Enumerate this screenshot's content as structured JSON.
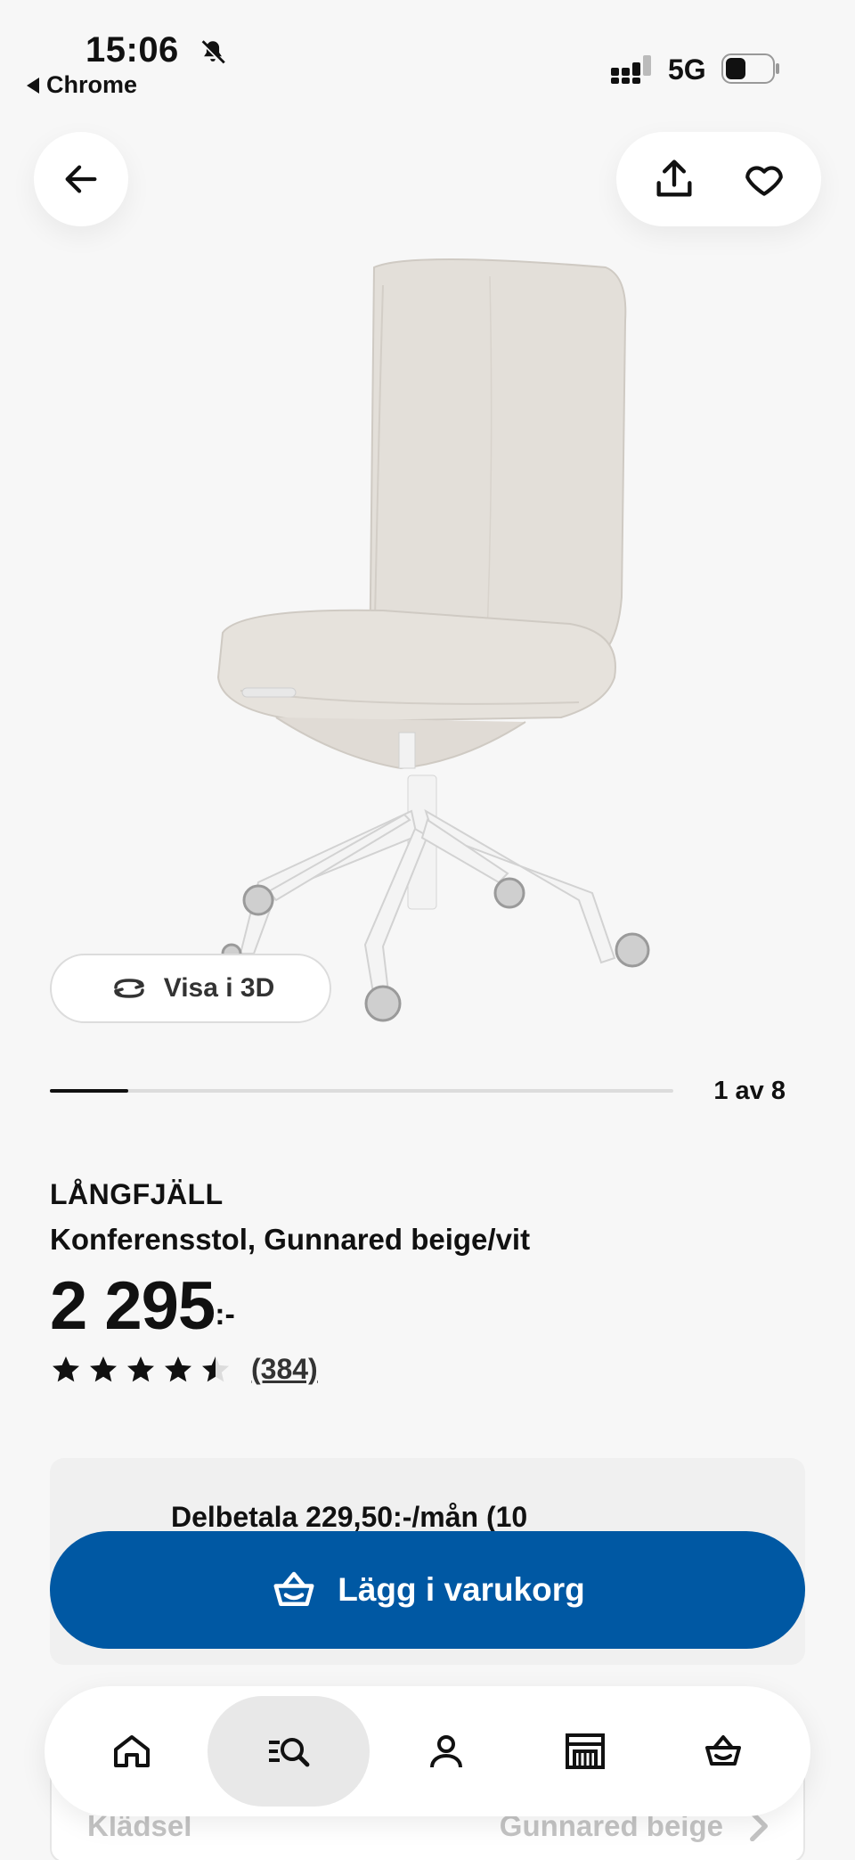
{
  "status_bar": {
    "time": "15:06",
    "back_app": "Chrome",
    "network": "5G"
  },
  "gallery": {
    "view_3d_label": "Visa i 3D",
    "counter": "1 av 8",
    "progress": 0.125
  },
  "product": {
    "brand": "LÅNGFJÄLL",
    "description": "Konferensstol, Gunnared beige/vit",
    "price": "2 295",
    "price_suffix": ":-",
    "rating": 4.5,
    "review_count": "(384)"
  },
  "installment": {
    "text": "Delbetala 229,50:-/mån (10"
  },
  "cart_button": {
    "label": "Lägg i varukorg"
  },
  "attribute_row": {
    "label": "Klädsel",
    "value": "Gunnared beige"
  },
  "tabbar": {
    "items": [
      "home-icon",
      "search-icon",
      "profile-icon",
      "store-icon",
      "cart-icon"
    ],
    "active": "search-icon"
  },
  "colors": {
    "primary": "#0058a3",
    "background": "#f7f7f7",
    "chair_fabric": "#e3dfd9"
  }
}
